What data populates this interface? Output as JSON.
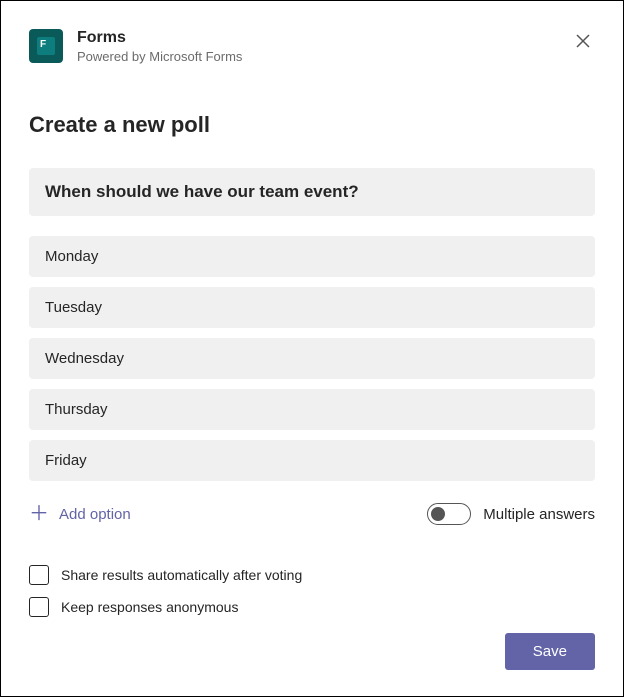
{
  "header": {
    "app_title": "Forms",
    "app_subtitle": "Powered by Microsoft Forms"
  },
  "page": {
    "title": "Create a new poll"
  },
  "poll": {
    "question": "When should we have our team event?",
    "options": [
      "Monday",
      "Tuesday",
      "Wednesday",
      "Thursday",
      "Friday"
    ]
  },
  "controls": {
    "add_option_label": "Add option",
    "multiple_answers_label": "Multiple answers",
    "share_results_label": "Share results automatically after voting",
    "keep_anonymous_label": "Keep responses anonymous",
    "save_label": "Save"
  }
}
